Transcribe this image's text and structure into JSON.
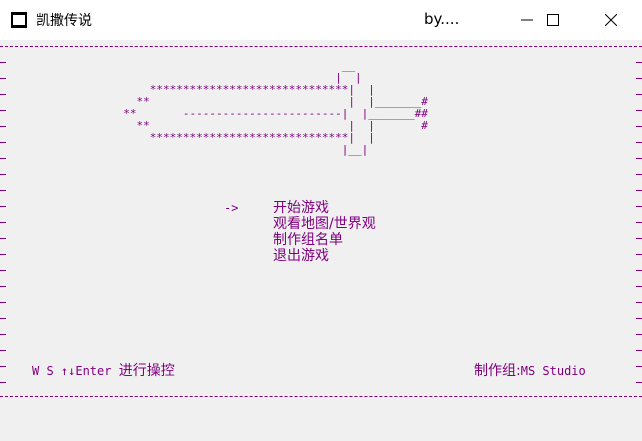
{
  "window": {
    "title": "凯撒传说",
    "subtitle": "by....",
    "buttons": [
      "minimize-icon",
      "maximize-icon",
      "close-icon"
    ]
  },
  "colors": {
    "console_text": "#800080",
    "background": "#f0f0f0"
  },
  "sword_art": [
    "                                   __",
    "                                  |  |",
    "      ******************************|  |",
    "    **                              |  |_______#",
    "  **       ------------------------|  |_______##",
    "    **                              |  |       #",
    "      ******************************|  |",
    "                                   |__|"
  ],
  "menu": {
    "cursor": "->",
    "items": [
      "开始游戏",
      "观看地图/世界观",
      "制作组名单",
      "退出游戏"
    ]
  },
  "footer": {
    "controls_prefix": "W S ↑↓Enter",
    "controls_text": "进行操控",
    "credit_label": "制作组:",
    "credit_value": "MS Studio"
  }
}
